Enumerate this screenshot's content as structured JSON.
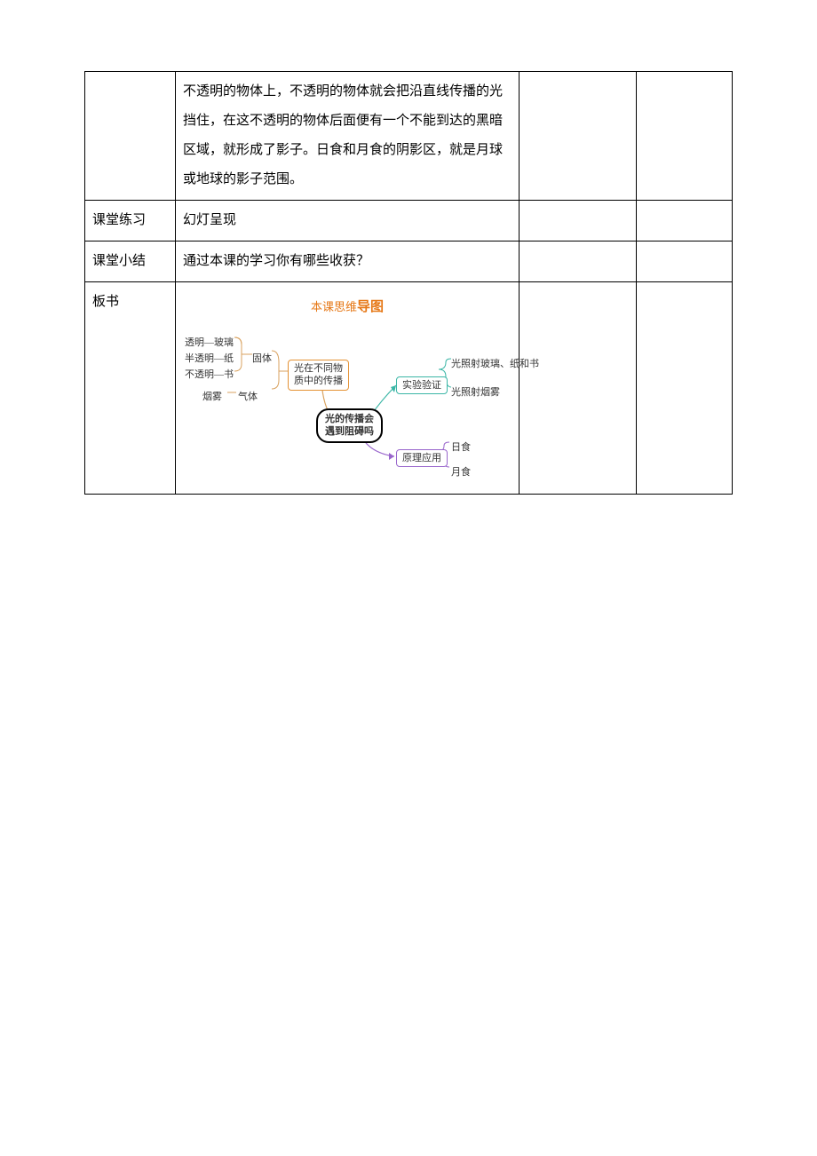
{
  "rows": {
    "r1": {
      "label": "",
      "content": "不透明的物体上，不透明的物体就会把沿直线传播的光挡住，在这不透明的物体后面便有一个不能到达的黑暗区域，就形成了影子。日食和月食的阴影区，就是月球或地球的影子范围。"
    },
    "r2": {
      "label": "课堂练习",
      "content": "幻灯呈现"
    },
    "r3": {
      "label": "课堂小结",
      "content": "通过本课的学习你有哪些收获？"
    },
    "r4": {
      "label": "板书"
    }
  },
  "mindmap": {
    "title_prefix": "本课思维",
    "title_bold": "导图",
    "left": {
      "items": [
        "透明—玻璃",
        "半透明—纸",
        "不透明—书"
      ],
      "group1": "固体",
      "item4": "烟雾",
      "suffix4": "气体",
      "box": "光在不同物\n质中的传播"
    },
    "center": "光的传播会\n遇到阻碍吗",
    "right_top": {
      "box": "实验验证",
      "items": [
        "光照射玻璃、纸和书",
        "光照射烟雾"
      ]
    },
    "right_bottom": {
      "box": "原理应用",
      "items": [
        "日食",
        "月食"
      ]
    }
  }
}
